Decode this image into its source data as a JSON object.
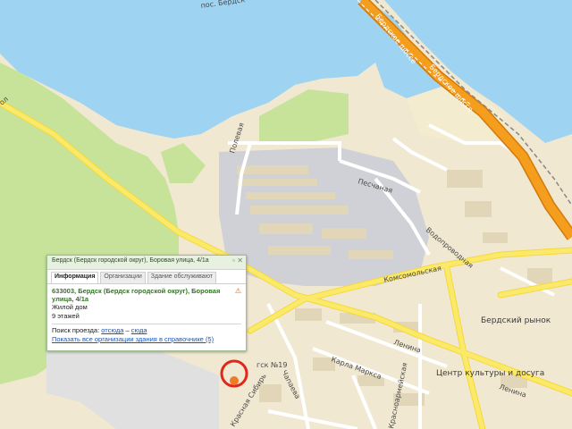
{
  "map": {
    "labels": {
      "road_top": "Бердское шоссе",
      "road_top2": "Бердское шоссе",
      "top_edge": "пос. Бердск",
      "street_pechanaya": "Песчаная",
      "street_polevaya": "Полевая",
      "street_vodoprovod": "Водопроводная",
      "street_komsomol": "Комсомольская",
      "street_lenina": "Ленина",
      "street_lenina2": "Ленина",
      "street_marksa": "Карла Маркса",
      "street_sibir": "Красная Сибирь",
      "street_chapaeva": "Чапаева",
      "street_krasnoarm": "Красноармейская",
      "street_left": "ол",
      "market": "Бердский рынок",
      "culture": "Центр культуры и досуга",
      "store": "гск №19"
    }
  },
  "popup": {
    "title": "Бердск (Бердск городской округ), Боровая улица, 4/1а",
    "tabs": [
      "Информация",
      "Организации",
      "Здание обслуживают"
    ],
    "address": "633003, Бердск (Бердск городской округ), Боровая улица, 4/1а",
    "type": "Жилой дом",
    "floors": "9 этажей",
    "route_label": "Поиск проезда:",
    "route_from": "отсюда",
    "route_dash": "–",
    "route_to": "сюда",
    "orgs_link": "Показать все организации здания в справочнике (5)"
  },
  "colors": {
    "water": "#9fd3f2",
    "land": "#f1e8d2",
    "park": "#c7e39a",
    "industrial": "#cfd1d6",
    "highway": "#f59d1c",
    "road": "#fbe96a",
    "marker": "#e0271c"
  }
}
